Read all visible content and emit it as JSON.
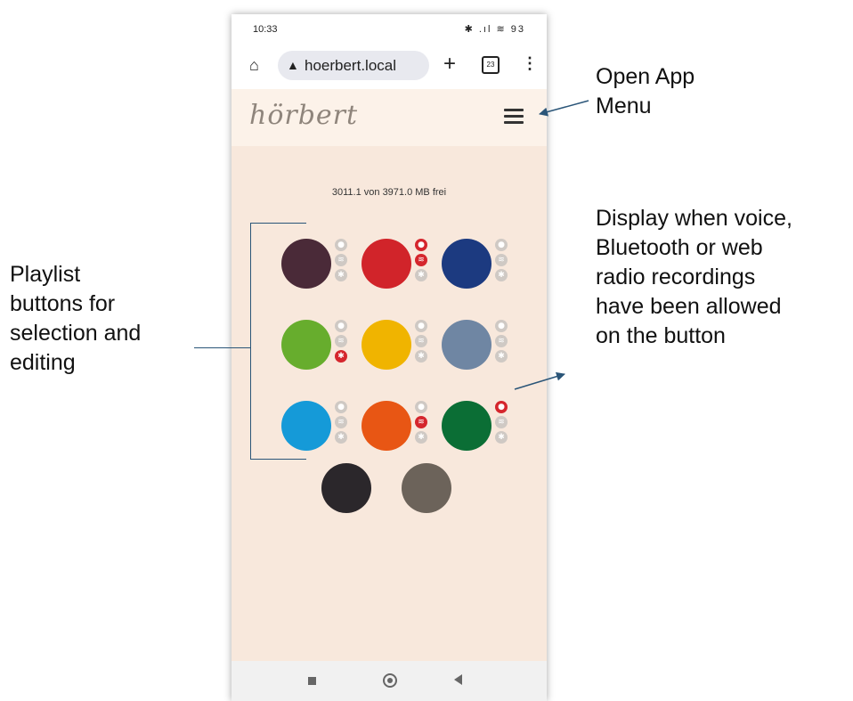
{
  "status_bar": {
    "time": "10:33",
    "icons": "✱ .ıl ≋ 93"
  },
  "browser": {
    "url": "hoerbert.local",
    "tab_count": "23"
  },
  "app": {
    "logo": "hörbert",
    "storage": "3011.1 von 3971.0 MB frei"
  },
  "playlists": [
    {
      "color": "#4a2a38",
      "voice": false,
      "wifi": false,
      "bt": false
    },
    {
      "color": "#d1242a",
      "voice": true,
      "wifi": true,
      "bt": false
    },
    {
      "color": "#1c3a80",
      "voice": false,
      "wifi": false,
      "bt": false
    },
    {
      "color": "#67ad2d",
      "voice": false,
      "wifi": false,
      "bt": true
    },
    {
      "color": "#f0b400",
      "voice": false,
      "wifi": false,
      "bt": false
    },
    {
      "color": "#6f86a3",
      "voice": false,
      "wifi": false,
      "bt": false
    },
    {
      "color": "#159ad8",
      "voice": false,
      "wifi": false,
      "bt": false
    },
    {
      "color": "#e85614",
      "voice": false,
      "wifi": true,
      "bt": false
    },
    {
      "color": "#0b6e35",
      "voice": true,
      "wifi": false,
      "bt": false
    },
    {
      "color": "#2b272b",
      "voice": false,
      "wifi": false,
      "bt": false
    },
    {
      "color": "#6c635a",
      "voice": false,
      "wifi": false,
      "bt": false
    }
  ],
  "annotations": {
    "open_menu": [
      "Open App",
      "Menu"
    ],
    "display": [
      "Display when voice,",
      "Bluetooth or web",
      "radio recordings",
      "have been allowed",
      "on the button"
    ],
    "playlist": [
      "Playlist",
      "buttons for",
      "selection and",
      "editing"
    ]
  },
  "colors": {
    "arrow": "#2a5578",
    "indicator_off": "#cfc9c4",
    "indicator_on": "#d5262d"
  }
}
